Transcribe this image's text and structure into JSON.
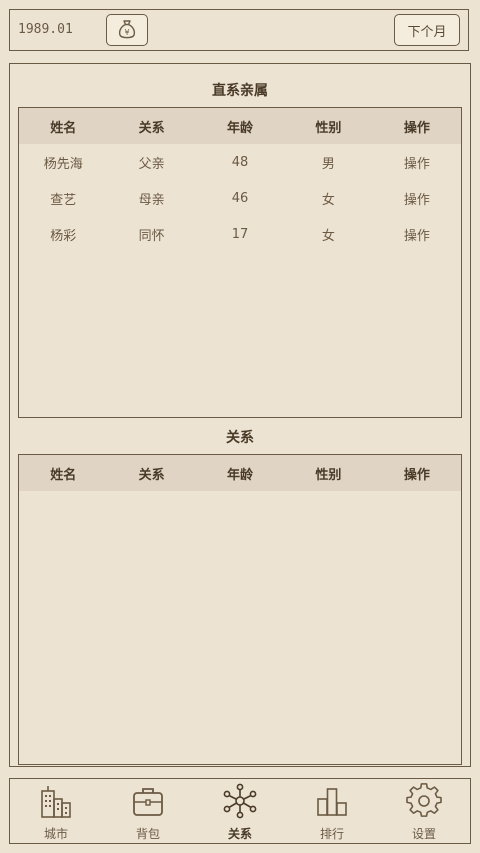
{
  "header": {
    "date": "1989.01",
    "money_icon": "money-bag-icon",
    "money_symbol": "¥",
    "next_month_label": "下个月"
  },
  "direct_relatives": {
    "title": "直系亲属",
    "columns": [
      "姓名",
      "关系",
      "年龄",
      "性别",
      "操作"
    ],
    "rows": [
      {
        "name": "杨先海",
        "relation": "父亲",
        "age": "48",
        "gender": "男",
        "action": "操作"
      },
      {
        "name": "查艺",
        "relation": "母亲",
        "age": "46",
        "gender": "女",
        "action": "操作"
      },
      {
        "name": "杨彩",
        "relation": "同怀",
        "age": "17",
        "gender": "女",
        "action": "操作"
      }
    ]
  },
  "relations": {
    "title": "关系",
    "columns": [
      "姓名",
      "关系",
      "年龄",
      "性别",
      "操作"
    ],
    "rows": []
  },
  "nav": {
    "items": [
      {
        "label": "城市",
        "icon": "city-icon",
        "active": false
      },
      {
        "label": "背包",
        "icon": "briefcase-icon",
        "active": false
      },
      {
        "label": "关系",
        "icon": "network-icon",
        "active": true
      },
      {
        "label": "排行",
        "icon": "ranking-icon",
        "active": false
      },
      {
        "label": "设置",
        "icon": "gear-icon",
        "active": false
      }
    ]
  },
  "colors": {
    "background": "#ede3d2",
    "border": "#6b5a44",
    "header_row": "#e0d5c5",
    "text": "#5a4a35"
  }
}
